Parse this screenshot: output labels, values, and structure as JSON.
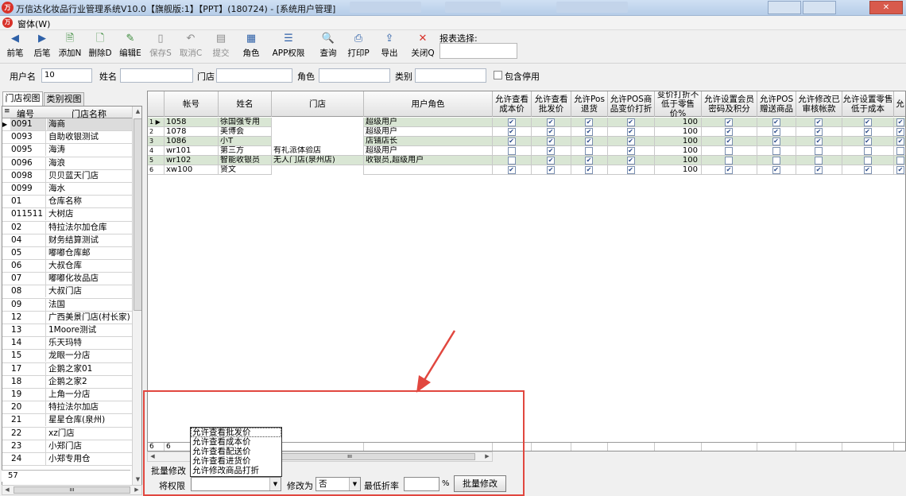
{
  "window": {
    "title": "万信达化妆品行业管理系统V10.0【旗舰版:1】【PPT】(180724) - [系统用户管理]",
    "icon_text": "万",
    "close_glyph": "✕"
  },
  "menubar": {
    "item": "窗体(W)"
  },
  "toolbar": {
    "buttons": [
      {
        "label": "前笔",
        "icon": "prev-arrow-icon",
        "glyph": "◀"
      },
      {
        "label": "后笔",
        "icon": "next-arrow-icon",
        "glyph": "▶"
      },
      {
        "label": "添加N",
        "icon": "add-doc-icon",
        "glyph": "🗎"
      },
      {
        "label": "删除D",
        "icon": "delete-doc-icon",
        "glyph": "🗋"
      },
      {
        "label": "编辑E",
        "icon": "edit-doc-icon",
        "glyph": "✎"
      },
      {
        "label": "保存S",
        "icon": "save-icon",
        "glyph": "▯"
      },
      {
        "label": "取消C",
        "icon": "undo-icon",
        "glyph": "↶"
      },
      {
        "label": "提交",
        "icon": "submit-icon",
        "glyph": "▤"
      },
      {
        "label": "角色",
        "icon": "role-icon",
        "glyph": "▦"
      },
      {
        "label": "APP权限",
        "icon": "app-permission-icon",
        "glyph": "☰"
      },
      {
        "label": "查询",
        "icon": "query-icon",
        "glyph": "🔍"
      },
      {
        "label": "打印P",
        "icon": "printer-icon",
        "glyph": "⎙"
      },
      {
        "label": "导出",
        "icon": "export-icon",
        "glyph": "⇪"
      },
      {
        "label": "关闭Q",
        "icon": "close-icon",
        "glyph": "✕"
      }
    ],
    "report_label": "报表选择:"
  },
  "filters": {
    "username_label": "用户名",
    "username_value": "10",
    "name_label": "姓名",
    "store_label": "门店",
    "role_label": "角色",
    "category_label": "类别",
    "include_disabled_label": "包含停用"
  },
  "left_panel": {
    "tabs": [
      "门店视图",
      "类别视图"
    ],
    "header_marker": "≡",
    "columns": [
      "编号",
      "门店名称"
    ],
    "rows": [
      [
        "0091",
        "海商"
      ],
      [
        "0093",
        "自助收银测试"
      ],
      [
        "0095",
        "海涛"
      ],
      [
        "0096",
        "海浪"
      ],
      [
        "0098",
        "贝贝蓝天门店"
      ],
      [
        "0099",
        "海水"
      ],
      [
        "01",
        "仓库名称"
      ],
      [
        "011511",
        "大树店"
      ],
      [
        "02",
        "特拉法尔加仓库"
      ],
      [
        "04",
        "财务结算测试"
      ],
      [
        "05",
        "嘟嘟仓库邮"
      ],
      [
        "06",
        "大叔仓库"
      ],
      [
        "07",
        "嘟嘟化妆品店"
      ],
      [
        "08",
        "大叔门店"
      ],
      [
        "09",
        "法国"
      ],
      [
        "12",
        "广西美景门店(村长家)"
      ],
      [
        "13",
        "1Moore测试"
      ],
      [
        "14",
        "乐天玛特"
      ],
      [
        "15",
        "龙眼一分店"
      ],
      [
        "17",
        "企鹅之家01"
      ],
      [
        "18",
        "企鹅之家2"
      ],
      [
        "19",
        "上角一分店"
      ],
      [
        "20",
        "特拉法尔加店"
      ],
      [
        "21",
        "星星仓库(泉州)"
      ],
      [
        "22",
        "xz门店"
      ],
      [
        "23",
        "小郑门店"
      ],
      [
        "24",
        "小郑专用仓"
      ]
    ],
    "selected_index": 0,
    "status": "57"
  },
  "main_grid": {
    "columns": [
      "帐号",
      "姓名",
      "门店",
      "用户角色",
      "允许查看成本价",
      "允许查看批发价",
      "允许Pos退货",
      "允许POS商品变价打折",
      "变价打折不低于零售价%",
      "允许设置会员密码及积分",
      "允许POS赠送商品",
      "允许修改已审核帐款",
      "允许设置零售低于成本",
      "允"
    ],
    "rows": [
      {
        "no": "1",
        "account": "1058",
        "name": "徐国强专用",
        "store": "",
        "role": "超级用户",
        "checks": [
          true,
          true,
          true,
          true
        ],
        "rate": "100",
        "checks2": [
          true,
          true,
          true,
          true
        ],
        "green": true,
        "current": true
      },
      {
        "no": "2",
        "account": "1078",
        "name": "美博会",
        "store": "",
        "role": "超级用户",
        "checks": [
          true,
          true,
          true,
          true
        ],
        "rate": "100",
        "checks2": [
          true,
          true,
          true,
          true
        ],
        "green": false,
        "current": false
      },
      {
        "no": "3",
        "account": "1086",
        "name": "小T",
        "store": "",
        "role": "店铺店长",
        "checks": [
          true,
          true,
          true,
          true
        ],
        "rate": "100",
        "checks2": [
          true,
          true,
          true,
          true
        ],
        "green": true,
        "current": false
      },
      {
        "no": "4",
        "account": "wr101",
        "name": "第三方",
        "store": "有礼派体验店",
        "role": "超级用户",
        "checks": [
          false,
          true,
          false,
          true
        ],
        "rate": "100",
        "checks2": [
          false,
          false,
          false,
          false
        ],
        "green": false,
        "current": false
      },
      {
        "no": "5",
        "account": "wr102",
        "name": "智能收银员",
        "store": "无人门店(泉州店)",
        "role": "收银员,超级用户",
        "checks": [
          false,
          true,
          true,
          true
        ],
        "rate": "100",
        "checks2": [
          false,
          false,
          false,
          false
        ],
        "green": true,
        "current": false
      },
      {
        "no": "6",
        "account": "xw100",
        "name": "贤文",
        "store": "",
        "role": "",
        "checks": [
          true,
          true,
          true,
          true
        ],
        "rate": "100",
        "checks2": [
          true,
          true,
          true,
          true
        ],
        "green": false,
        "current": false
      }
    ],
    "status_count": "6",
    "status_value": "6"
  },
  "batch": {
    "title": "批量修改",
    "perm_label": "将权限",
    "modify_label": "修改为",
    "modify_value": "否",
    "rate_label": "最低折率",
    "rate_unit": "%",
    "button_label": "批量修改",
    "perm_options": [
      "允许查看批发价",
      "允许查看成本价",
      "允许查看配送价",
      "允许查看进货价",
      "允许修改商品打折"
    ]
  },
  "colors": {
    "accent": "#2f61a8",
    "annotation": "#e1473f",
    "row_green": "#d9e6d4"
  }
}
